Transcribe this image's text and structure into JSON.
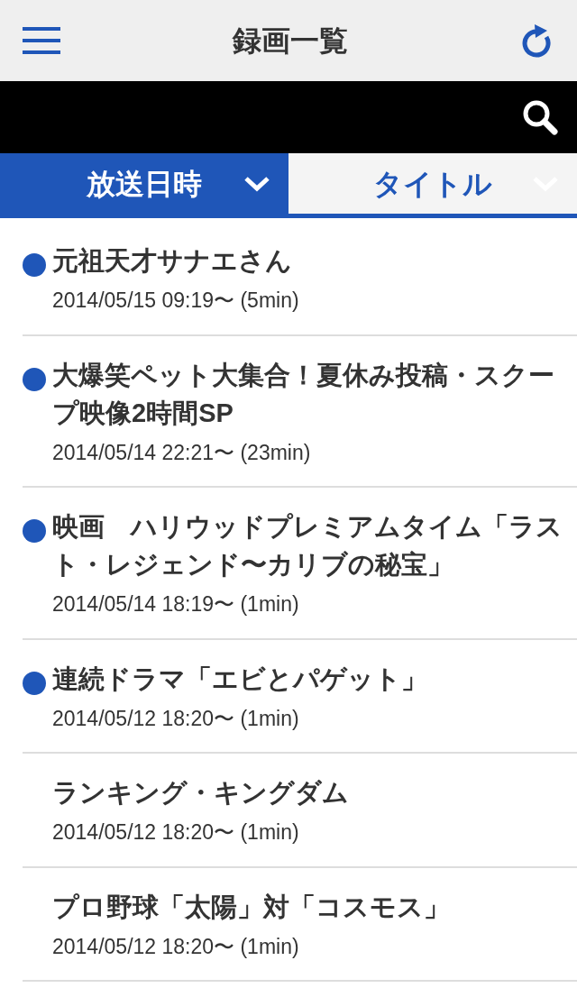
{
  "header": {
    "title": "録画一覧"
  },
  "sort_tabs": [
    {
      "label": "放送日時",
      "selected": true
    },
    {
      "label": "タイトル",
      "selected": false
    }
  ],
  "recordings": [
    {
      "title": "元祖天才サナエさん",
      "info": "2014/05/15 09:19〜 (5min)",
      "unwatched": true
    },
    {
      "title": "大爆笑ペット大集合！夏休み投稿・スクープ映像2時間SP",
      "info": "2014/05/14 22:21〜 (23min)",
      "unwatched": true
    },
    {
      "title": "映画　ハリウッドプレミアムタイム「ラスト・レジェンド〜カリブの秘宝」",
      "info": "2014/05/14 18:19〜 (1min)",
      "unwatched": true
    },
    {
      "title": "連続ドラマ「エビとパゲット」",
      "info": "2014/05/12 18:20〜 (1min)",
      "unwatched": true
    },
    {
      "title": "ランキング・キングダム",
      "info": "2014/05/12 18:20〜 (1min)",
      "unwatched": false
    },
    {
      "title": "プロ野球「太陽」対「コスモス」",
      "info": "2014/05/12 18:20〜 (1min)",
      "unwatched": false
    }
  ]
}
